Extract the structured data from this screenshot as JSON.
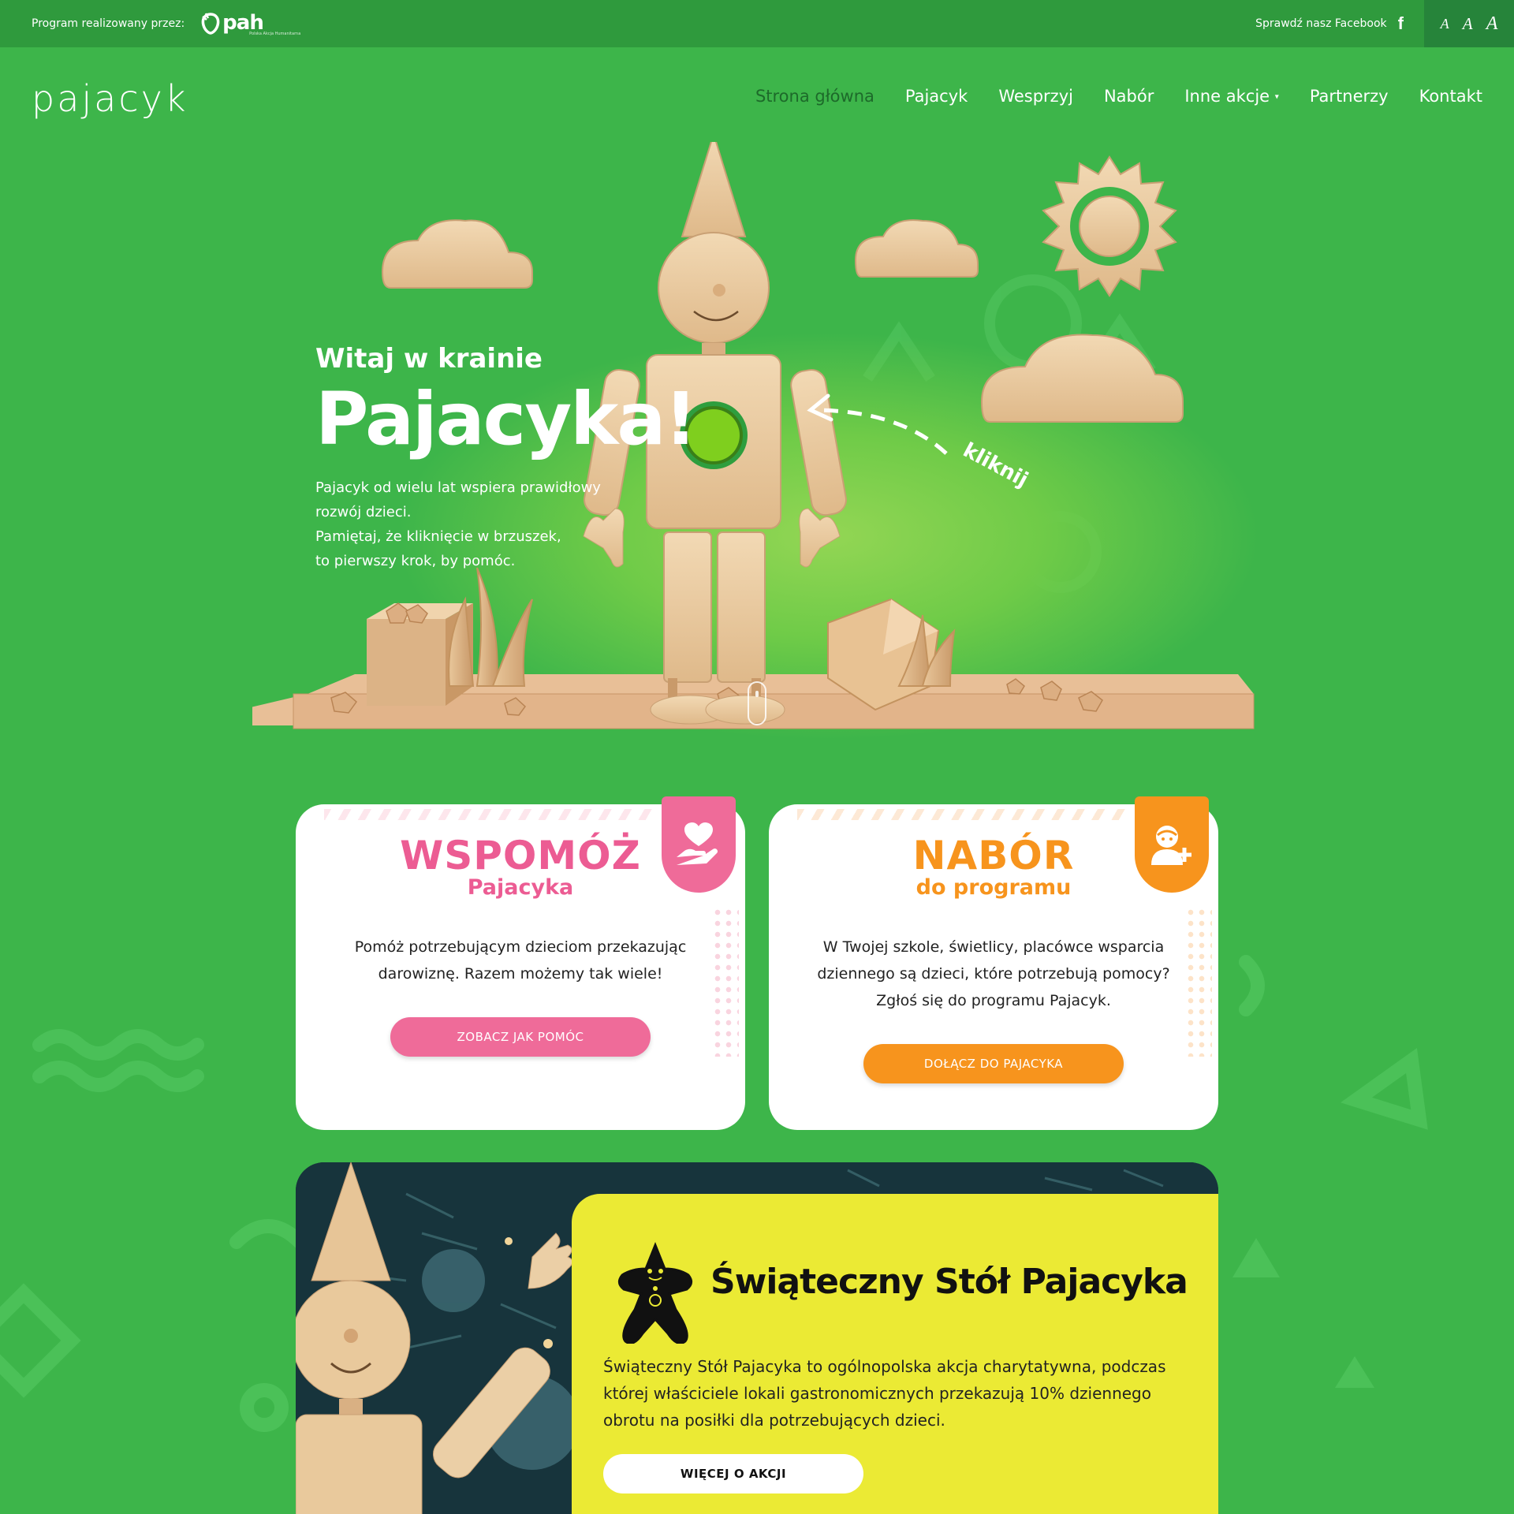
{
  "topbar": {
    "program_label": "Program realizowany przez:",
    "pah_logo_text": "pah",
    "pah_logo_sub": "Polska Akcja Humanitarna",
    "facebook_label": "Sprawdź nasz Facebook",
    "facebook_icon": "f",
    "font_size_small": "A",
    "font_size_medium": "A",
    "font_size_large": "A"
  },
  "header": {
    "logo": "pajacyk",
    "nav": [
      {
        "label": "Strona główna",
        "active": true
      },
      {
        "label": "Pajacyk"
      },
      {
        "label": "Wesprzyj"
      },
      {
        "label": "Nabór"
      },
      {
        "label": "Inne akcje",
        "dropdown": true
      },
      {
        "label": "Partnerzy"
      },
      {
        "label": "Kontakt"
      }
    ],
    "dropdown_caret": "▾"
  },
  "hero": {
    "title_small": "Witaj w krainie",
    "title_big": "Pajacyka!",
    "text_line1": "Pajacyk od wielu lat wspiera prawidłowy",
    "text_line2": "rozwój dzieci.",
    "text_line3": "Pamiętaj, że kliknięcie w brzuszek,",
    "text_line4": "to pierwszy krok, by pomóc.",
    "click_hint": "kliknij"
  },
  "cards": {
    "help": {
      "title": "WSPOMÓŻ",
      "subtitle": "Pajacyka",
      "text": "Pomóż potrzebującym dzieciom przekazując darowiznę. Razem możemy tak wiele!",
      "button": "ZOBACZ JAK POMÓC",
      "icon": "heart-hand-icon",
      "color": "#ef6b99"
    },
    "recruit": {
      "title": "NABÓR",
      "subtitle": "do programu",
      "text": "W Twojej szkole, świetlicy, placówce wsparcia dziennego są dzieci, które potrzebują pomocy? Zgłoś się do programu Pajacyk.",
      "button": "DOŁĄCZ DO PAJACYKA",
      "icon": "child-add-icon",
      "color": "#f7941d"
    }
  },
  "promo": {
    "title": "Świąteczny Stół Pajacyka",
    "text": "Świąteczny Stół Pajacyka to ogólnopolska akcja charytatywna, podczas której właściciele lokali gastronomicznych przekazują 10% dziennego obrotu na posiłki dla potrzebujących dzieci.",
    "button": "WIĘCEJ O AKCJI",
    "icon": "gingerbread-icon",
    "color": "#ebea34"
  }
}
